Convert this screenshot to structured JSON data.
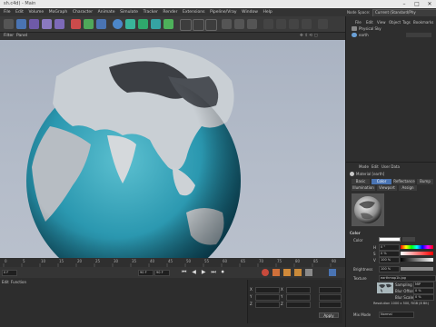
{
  "titlebar": {
    "title": "sh.c4d) - Main",
    "minimize": "–",
    "maximize": "□",
    "close": "✕"
  },
  "menu": [
    "File",
    "Edit",
    "Volume",
    "MoGraph",
    "Character",
    "Animate",
    "Simulate",
    "Tracker",
    "Render",
    "Extensions",
    "Pipeline/Vray",
    "Window",
    "Help"
  ],
  "nodespace": {
    "label": "Node Space:",
    "layout": "Current (Standard/Phy"
  },
  "viewport": {
    "menus": [
      "Filter",
      "Panel"
    ]
  },
  "objects": {
    "menus": [
      "File",
      "Edit",
      "View",
      "Object",
      "Tags",
      "Bookmarks"
    ],
    "items": [
      "Physical Sky",
      "earth"
    ]
  },
  "timeline": {
    "ticks": [
      "0",
      "5",
      "10",
      "15",
      "20",
      "25",
      "30",
      "35",
      "40",
      "45",
      "50",
      "55",
      "60",
      "65",
      "70",
      "75",
      "80",
      "85",
      "90"
    ],
    "frame_start": "0 F",
    "frame_end": "90 F",
    "frame_end2": "90 F"
  },
  "lowerpanel": {
    "tabs": [
      "Edit",
      "Function"
    ],
    "coords": [
      "X",
      "Y",
      "Z"
    ],
    "apply": "Apply"
  },
  "attributes": {
    "menus": [
      "Mode",
      "Edit",
      "User Data"
    ],
    "material_name": "Material [earth]",
    "tabs_row1": [
      "Basic",
      "Color",
      "Reflectance",
      "Bump"
    ],
    "tabs_row2": [
      "Illumination",
      "Viewport",
      "Assign"
    ],
    "section": "Color",
    "color_label": "Color",
    "h": "H",
    "h_val": "0 °",
    "s": "S",
    "s_val": "0 %",
    "v": "V",
    "v_val": "100 %",
    "brightness_label": "Brightness",
    "brightness_val": "100 %",
    "texture_label": "Texture",
    "texture_name": "earthmap1k.jpg",
    "sampling_label": "Sampling",
    "sampling_val": "MIP",
    "bluroffset_label": "Blur Offset",
    "bluroffset_val": "0 %",
    "blurscale_label": "Blur Scale",
    "blurscale_val": "0 %",
    "resolution": "Resolution 1000 x 500, RGB (8 Bit)",
    "mixmode_label": "Mix Mode",
    "mixmode_val": "Normal",
    "colors": {
      "accent": "#4a74b3",
      "color_swatch": "#ffffff"
    }
  }
}
